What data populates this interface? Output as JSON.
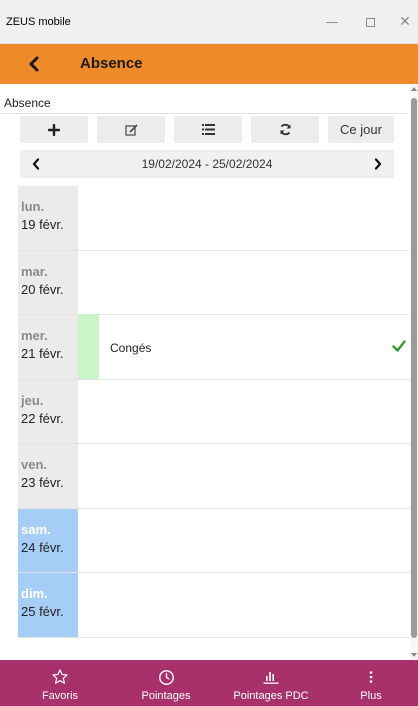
{
  "window": {
    "title": "ZEUS mobile"
  },
  "header": {
    "title": "Absence"
  },
  "section": {
    "label": "Absence"
  },
  "toolbar": {
    "today_label": "Ce jour"
  },
  "week": {
    "range": "19/02/2024 - 25/02/2024"
  },
  "days": [
    {
      "name": "lun.",
      "date": "19 févr.",
      "weekend": false,
      "event": ""
    },
    {
      "name": "mar.",
      "date": "20 févr.",
      "weekend": false,
      "event": ""
    },
    {
      "name": "mer.",
      "date": "21 févr.",
      "weekend": false,
      "event": "Congés",
      "event_status": "approved"
    },
    {
      "name": "jeu.",
      "date": "22 févr.",
      "weekend": false,
      "event": ""
    },
    {
      "name": "ven.",
      "date": "23 févr.",
      "weekend": false,
      "event": ""
    },
    {
      "name": "sam.",
      "date": "24 févr.",
      "weekend": true,
      "event": ""
    },
    {
      "name": "dim.",
      "date": "25 févr.",
      "weekend": true,
      "event": ""
    }
  ],
  "bottom_nav": [
    {
      "label": "Favoris",
      "icon": "star-icon"
    },
    {
      "label": "Pointages",
      "icon": "clock-icon"
    },
    {
      "label": "Pointages PDC",
      "icon": "bar-chart-icon"
    },
    {
      "label": "Plus",
      "icon": "more-vertical-icon"
    }
  ],
  "colors": {
    "header": "#ef8a2a",
    "bottom_nav": "#a8316b",
    "weekend": "#a6cdf5",
    "event": "#c9f6c8",
    "check": "#2e9b2e"
  }
}
